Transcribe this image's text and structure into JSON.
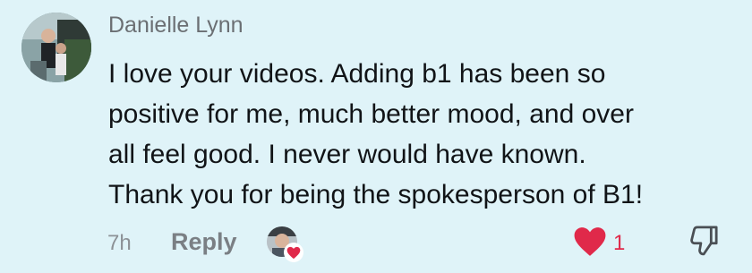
{
  "comment": {
    "author": "Danielle Lynn",
    "body_lines": [
      "I love your videos. Adding b1 has been so",
      "positive for me, much better mood, and over",
      "all feel good. I never would have known.",
      "Thank you for being the spokesperson of B1!"
    ],
    "timestamp": "7h",
    "reply_label": "Reply",
    "like_count": "1",
    "liked": true,
    "creator_liked": true
  },
  "icons": {
    "avatar": "user-photo-avatar",
    "creator_avatar": "creator-avatar-with-heart",
    "like": "heart-icon",
    "dislike": "thumbs-down-icon"
  },
  "colors": {
    "background": "#dff3f8",
    "like_red": "#e0294a",
    "author_gray": "#6b6f73",
    "text": "#111417"
  }
}
